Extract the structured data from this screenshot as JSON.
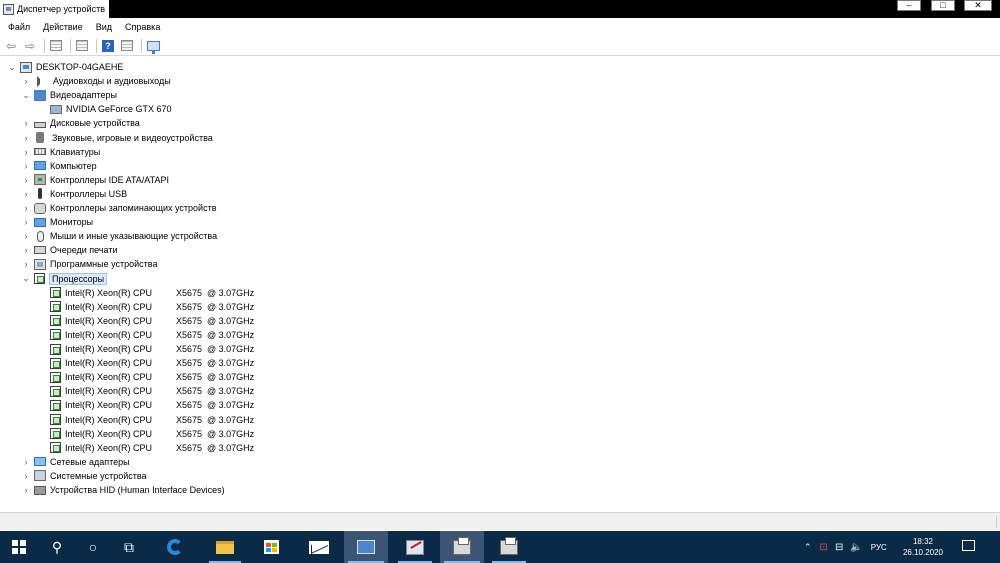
{
  "window": {
    "title": "Диспетчер устройств",
    "buttons": {
      "minimize": "–",
      "maximize": "□",
      "close": "✕"
    }
  },
  "menu": [
    "Файл",
    "Действие",
    "Вид",
    "Справка"
  ],
  "toolbar": {
    "items": [
      "back-arrow-icon",
      "forward-arrow-icon",
      "properties-grid-icon",
      "list-view-icon",
      "help-icon",
      "details-grid-icon",
      "monitor-scan-icon"
    ]
  },
  "tree": {
    "root": "DESKTOP-04GAEHE",
    "categories": [
      {
        "label": "Аудиовходы и аудиовыходы",
        "icon": "speaker-icon",
        "expanded": false
      },
      {
        "label": "Видеоадаптеры",
        "icon": "display-adapter-icon",
        "expanded": true,
        "children": [
          "NVIDIA GeForce GTX 670"
        ]
      },
      {
        "label": "Дисковые устройства",
        "icon": "disk-drive-icon",
        "expanded": false
      },
      {
        "label": "Звуковые, игровые и видеоустройства",
        "icon": "sound-device-icon",
        "expanded": false
      },
      {
        "label": "Клавиатуры",
        "icon": "keyboard-icon",
        "expanded": false
      },
      {
        "label": "Компьютер",
        "icon": "computer-icon",
        "expanded": false
      },
      {
        "label": "Контроллеры IDE ATA/ATAPI",
        "icon": "ide-controller-icon",
        "expanded": false
      },
      {
        "label": "Контроллеры USB",
        "icon": "usb-icon",
        "expanded": false
      },
      {
        "label": "Контроллеры запоминающих устройств",
        "icon": "storage-controller-icon",
        "expanded": false
      },
      {
        "label": "Мониторы",
        "icon": "monitor-icon",
        "expanded": false
      },
      {
        "label": "Мыши и иные указывающие устройства",
        "icon": "mouse-icon",
        "expanded": false
      },
      {
        "label": "Очереди печати",
        "icon": "printer-queue-icon",
        "expanded": false
      },
      {
        "label": "Программные устройства",
        "icon": "software-device-icon",
        "expanded": false
      },
      {
        "label": "Процессоры",
        "icon": "processor-icon",
        "expanded": true,
        "selected": true
      },
      {
        "label": "Сетевые адаптеры",
        "icon": "network-adapter-icon",
        "expanded": false
      },
      {
        "label": "Системные устройства",
        "icon": "system-device-icon",
        "expanded": false
      },
      {
        "label": "Устройства HID (Human Interface Devices)",
        "icon": "hid-icon",
        "expanded": false
      }
    ],
    "processors": {
      "name": "Intel(R) Xeon(R) CPU",
      "model": "X5675  @ 3.07GHz",
      "count": 12
    }
  },
  "taskbar": {
    "icons": [
      "windows-start-icon",
      "search-icon",
      "cortana-circle-icon",
      "task-view-icon",
      "edge-browser-icon",
      "file-explorer-icon",
      "store-icon",
      "mail-icon",
      "device-manager-icon",
      "image-editor-icon",
      "printer-app-icon",
      "printer-app-icon"
    ],
    "language": "РУС",
    "time": "18:32",
    "date": "26.10.2020"
  }
}
